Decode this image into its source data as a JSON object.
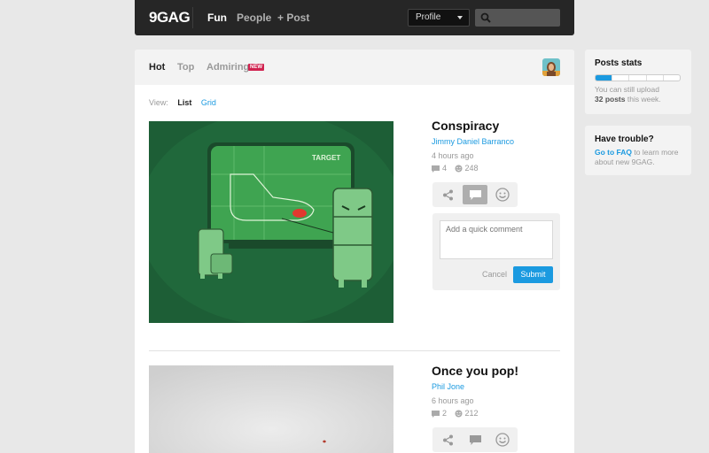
{
  "header": {
    "logo": "9GAG",
    "nav": [
      "Fun",
      "People",
      "+ Post"
    ],
    "profile_label": "Profile"
  },
  "tabs": {
    "hot": "Hot",
    "top": "Top",
    "admiring": "Admiring",
    "new_badge": "NEW"
  },
  "view": {
    "label": "View:",
    "list": "List",
    "grid": "Grid"
  },
  "posts": [
    {
      "title": "Conspiracy",
      "author": "Jimmy Daniel Barranco",
      "time": "4 hours ago",
      "comments": "4",
      "likes": "248",
      "image_text": "TARGET"
    },
    {
      "title": "Once you pop!",
      "author": "Phil Jone",
      "time": "6 hours ago",
      "comments": "2",
      "likes": "212"
    }
  ],
  "comment_box": {
    "placeholder": "Add a quick comment",
    "cancel": "Cancel",
    "submit": "Submit"
  },
  "sidebar": {
    "stats": {
      "title": "Posts stats",
      "text_prefix": "You can still upload",
      "count_text": "32 posts",
      "text_suffix": "this week.",
      "progress": 0.35
    },
    "trouble": {
      "title": "Have trouble?",
      "link": "Go to FAQ",
      "text": "to learn more about new 9GAG."
    }
  },
  "colors": {
    "accent": "#1b9ae0",
    "header_bg": "#262626",
    "badge": "#d0224f",
    "image_green": "#1f6b3a"
  }
}
